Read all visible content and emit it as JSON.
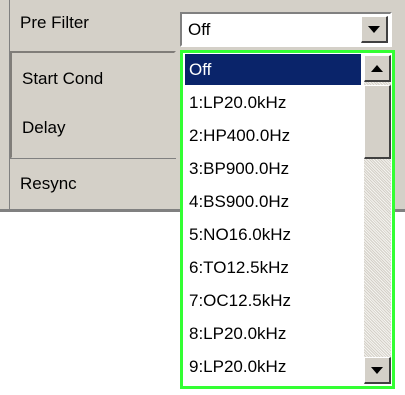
{
  "settings": {
    "rows": [
      {
        "label": "Pre Filter"
      },
      {
        "label": "Start Cond"
      },
      {
        "label": "Delay"
      },
      {
        "label": "Resync"
      }
    ]
  },
  "pre_filter": {
    "current_value": "Off",
    "options": [
      "Off",
      "1:LP20.0kHz",
      "2:HP400.0Hz",
      "3:BP900.0Hz",
      "4:BS900.0Hz",
      "5:NO16.0kHz",
      "6:TO12.5kHz",
      "7:OC12.5kHz",
      "8:LP20.0kHz",
      "9:LP20.0kHz"
    ],
    "highlighted_index": 0
  },
  "colors": {
    "panel": "#d4d0c8",
    "highlight": "#0a246a",
    "dropdown_border": "#33ff33"
  }
}
